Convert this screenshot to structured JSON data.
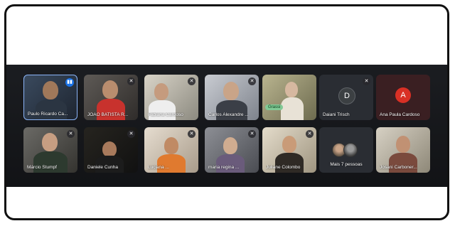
{
  "participants": [
    {
      "name": "Paulo Ricardo Ca...",
      "icon": "speaking-icon"
    },
    {
      "name": "JOÃO BATISTA R...",
      "icon": "mic-off-icon"
    },
    {
      "name": "Fabiana Cardoso",
      "icon": "mic-off-icon"
    },
    {
      "name": "Carlos Alexandre ...",
      "icon": "mic-off-icon"
    },
    {
      "name": "",
      "icon": "",
      "badge": "Grassi"
    },
    {
      "name": "Daiani Trisch",
      "icon": "mic-off-icon",
      "initial": "D",
      "color": "#3c4043"
    },
    {
      "name": "Ana Paula Cardoso",
      "icon": "",
      "initial": "A",
      "color": "#d93025"
    },
    {
      "name": "Márcio Stumpf",
      "icon": "mic-off-icon"
    },
    {
      "name": "Daniele Cunha",
      "icon": "mic-off-icon"
    },
    {
      "name": "Luciana ...",
      "icon": "mic-off-icon"
    },
    {
      "name": "maria regina ...",
      "icon": "mic-off-icon"
    },
    {
      "name": "Juliane Colombo",
      "icon": "mic-off-icon"
    },
    {
      "name": "Mais 7 pessoas",
      "icon": ""
    },
    {
      "name": "Josani Carboner...",
      "icon": ""
    }
  ]
}
